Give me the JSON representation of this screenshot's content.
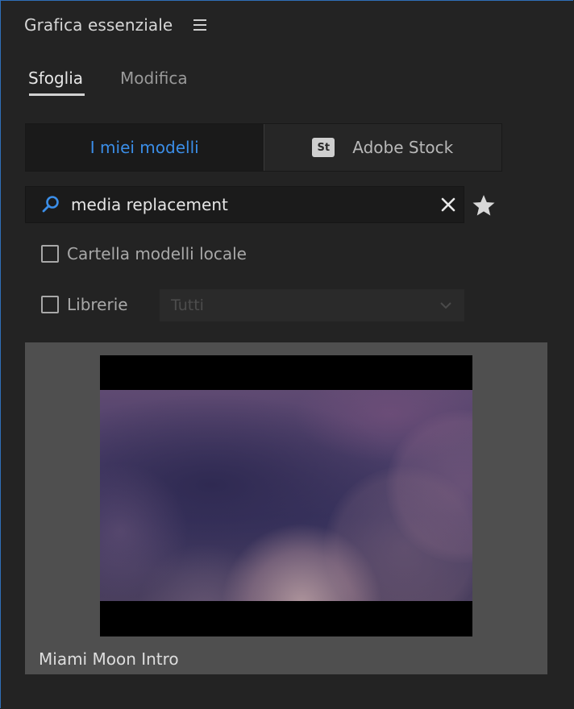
{
  "panel": {
    "title": "Grafica essenziale",
    "menu_icon": "hamburger-menu-icon"
  },
  "tabs": [
    {
      "label": "Sfoglia",
      "active": true
    },
    {
      "label": "Modifica",
      "active": false
    }
  ],
  "source_toggle": {
    "my_templates": "I miei modelli",
    "stock_badge": "St",
    "stock": "Adobe Stock",
    "active_color": "#3b8ee8"
  },
  "search": {
    "icon": "search-icon",
    "value": "media replacement",
    "clear_icon": "clear-icon",
    "favorite_icon": "star-icon"
  },
  "filters": {
    "local_folder": {
      "label": "Cartella modelli locale",
      "checked": false
    },
    "libraries": {
      "label": "Librerie",
      "checked": false,
      "select_value": "Tutti",
      "select_icon": "chevron-down-icon"
    }
  },
  "results": [
    {
      "title": "Miami Moon Intro"
    }
  ]
}
